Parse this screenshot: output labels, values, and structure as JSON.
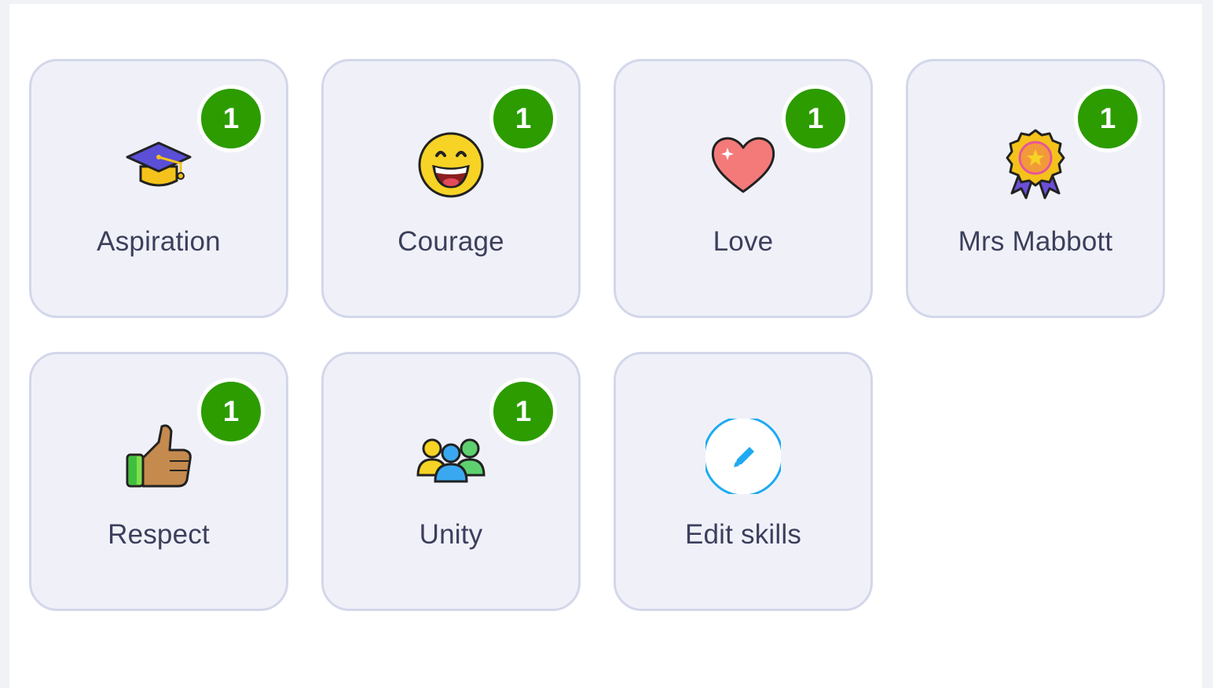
{
  "skills": [
    {
      "label": "Aspiration",
      "count": "1",
      "icon": "graduation-cap-icon"
    },
    {
      "label": "Courage",
      "count": "1",
      "icon": "smiley-face-icon"
    },
    {
      "label": "Love",
      "count": "1",
      "icon": "heart-icon"
    },
    {
      "label": "Mrs Mabbott",
      "count": "1",
      "icon": "award-rosette-icon"
    },
    {
      "label": "Respect",
      "count": "1",
      "icon": "thumbs-up-icon"
    },
    {
      "label": "Unity",
      "count": "1",
      "icon": "group-people-icon"
    }
  ],
  "edit": {
    "label": "Edit skills",
    "icon": "pencil-circle-icon"
  },
  "colors": {
    "badge": "#2c9c00",
    "tile_background": "#f0f1f8",
    "tile_border": "#d3d7ea",
    "label_text": "#3c3f5c",
    "edit_accent": "#1eaaf0"
  }
}
